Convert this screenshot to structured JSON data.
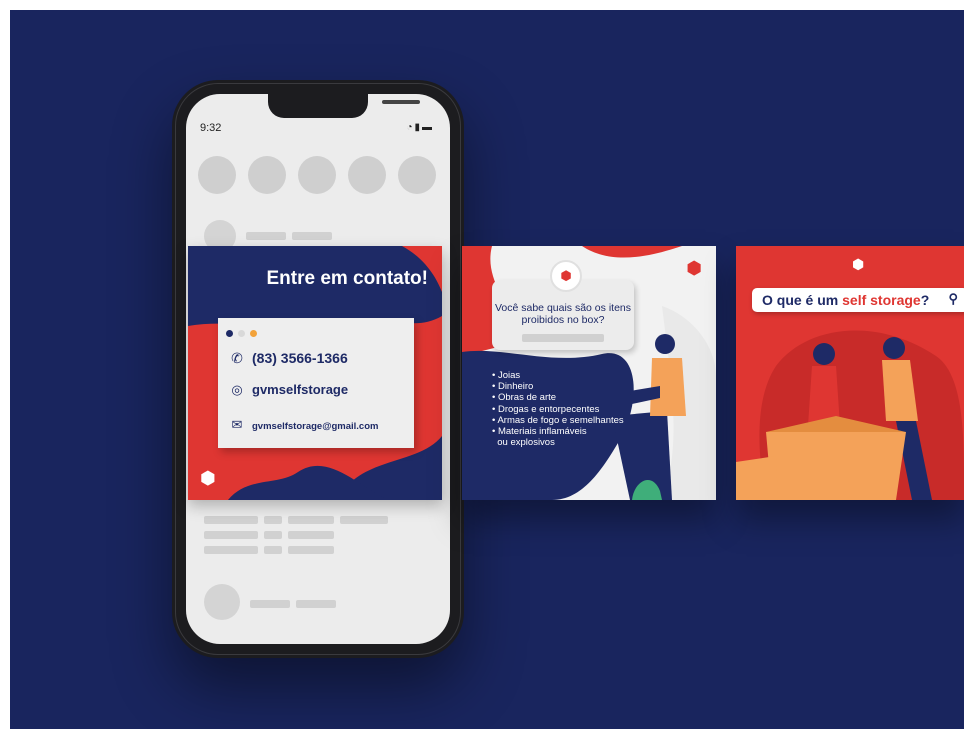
{
  "phone": {
    "status_time": "9:32",
    "status_icons": "wifi-icon signal-icon battery-icon"
  },
  "contact_post": {
    "title": "Entre em contato!",
    "dot_colors": [
      "#1e2a66",
      "#d9d9d9",
      "#f2a23a"
    ],
    "phone_number": "(83) 3566-1366",
    "instagram": "gvmselfstorage",
    "email": "gvmselfstorage@gmail.com",
    "icons": {
      "phone": "whatsapp-icon",
      "instagram": "instagram-icon",
      "email": "mail-icon",
      "logo": "box-logo-icon"
    }
  },
  "items_post": {
    "question": "Você sabe quais são os itens proibidos no box?",
    "items": [
      "• Joias",
      "• Dinheiro",
      "• Obras de arte",
      "• Drogas e entorpecentes",
      "• Armas de fogo e semelhantes",
      "• Materiais inflamáveis",
      "  ou explosivos"
    ]
  },
  "storage_post": {
    "search_prefix": "O que é um ",
    "search_highlight": "self storage",
    "search_suffix": "?",
    "icons": {
      "search": "search-icon",
      "logo": "box-logo-icon"
    }
  },
  "colors": {
    "background": "#19255e",
    "brand_red": "#df3632",
    "brand_navy": "#1e2a66",
    "accent_orange": "#f2a23a"
  }
}
